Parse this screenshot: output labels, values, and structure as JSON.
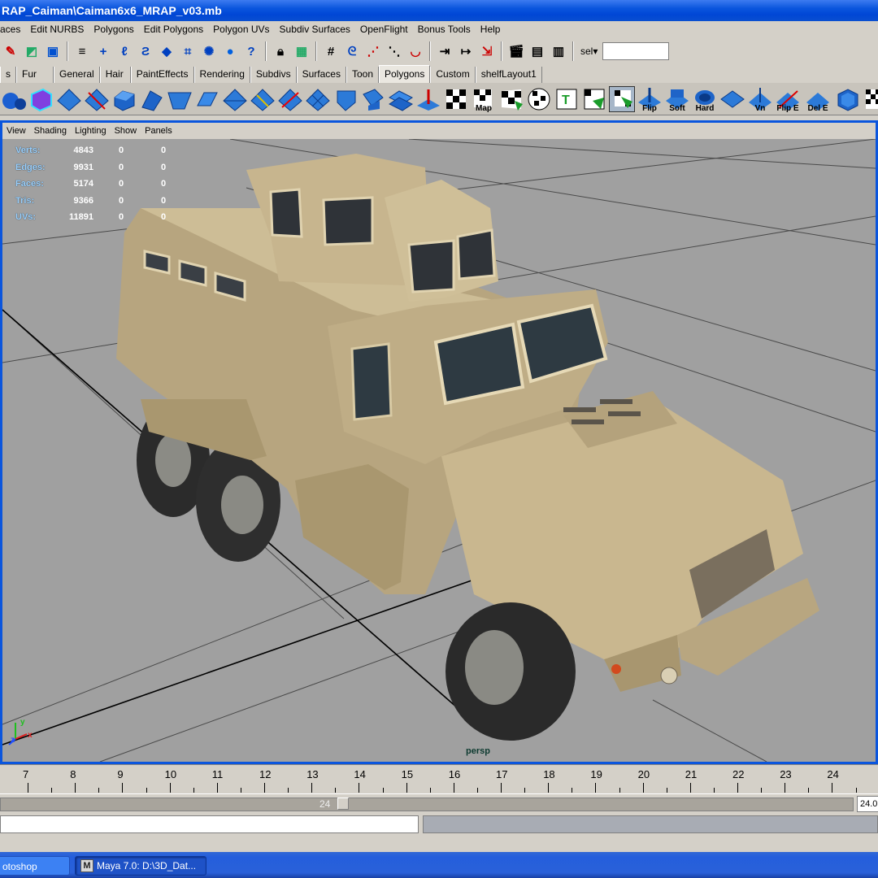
{
  "window": {
    "title": "RAP_Caiman\\Caiman6x6_MRAP_v03.mb"
  },
  "menubar": [
    "aces",
    "Edit NURBS",
    "Polygons",
    "Edit Polygons",
    "Polygon UVs",
    "Subdiv Surfaces",
    "OpenFlight",
    "Bonus Tools",
    "Help"
  ],
  "statusline": {
    "sel_label": "sel▾",
    "sel_value": ""
  },
  "shelf_tabs": [
    {
      "label": "s",
      "active": false
    },
    {
      "label": "Fur",
      "active": false
    },
    {
      "label": "General",
      "active": false
    },
    {
      "label": "Hair",
      "active": false
    },
    {
      "label": "PaintEffects",
      "active": false
    },
    {
      "label": "Rendering",
      "active": false
    },
    {
      "label": "Subdivs",
      "active": false
    },
    {
      "label": "Surfaces",
      "active": false
    },
    {
      "label": "Toon",
      "active": false
    },
    {
      "label": "Polygons",
      "active": true
    },
    {
      "label": "Custom",
      "active": false
    },
    {
      "label": "shelfLayout1",
      "active": false
    }
  ],
  "shelf_labels": {
    "map": "Map",
    "flip": "Flip",
    "soft": "Soft",
    "hard": "Hard",
    "vn": "Vn",
    "flip_e": "Flip E",
    "del_e": "Del E"
  },
  "panel_menu": [
    "View",
    "Shading",
    "Lighting",
    "Show",
    "Panels"
  ],
  "hud": [
    {
      "label": "Verts:",
      "value": "4843",
      "a": "0",
      "b": "0"
    },
    {
      "label": "Edges:",
      "value": "9931",
      "a": "0",
      "b": "0"
    },
    {
      "label": "Faces:",
      "value": "5174",
      "a": "0",
      "b": "0"
    },
    {
      "label": "Tris:",
      "value": "9366",
      "a": "0",
      "b": "0"
    },
    {
      "label": "UVs:",
      "value": "11891",
      "a": "0",
      "b": "0"
    }
  ],
  "camera": "persp",
  "axis": {
    "x": "x",
    "y": "y",
    "z": "z"
  },
  "timeslider": {
    "ticks": [
      "7",
      "8",
      "9",
      "10",
      "11",
      "12",
      "13",
      "14",
      "15",
      "16",
      "17",
      "18",
      "19",
      "20",
      "21",
      "22",
      "23",
      "24"
    ]
  },
  "range": {
    "current": "24",
    "end": "24.0"
  },
  "taskbar": {
    "task1": "otoshop",
    "task2": "Maya 7.0: D:\\3D_Dat..."
  },
  "colors": {
    "title_bar": "#0a55dd",
    "viewport_bg": "#a0a0a0",
    "hud_label": "#9ad1ff",
    "vehicle_tan": "#c8b48a"
  }
}
